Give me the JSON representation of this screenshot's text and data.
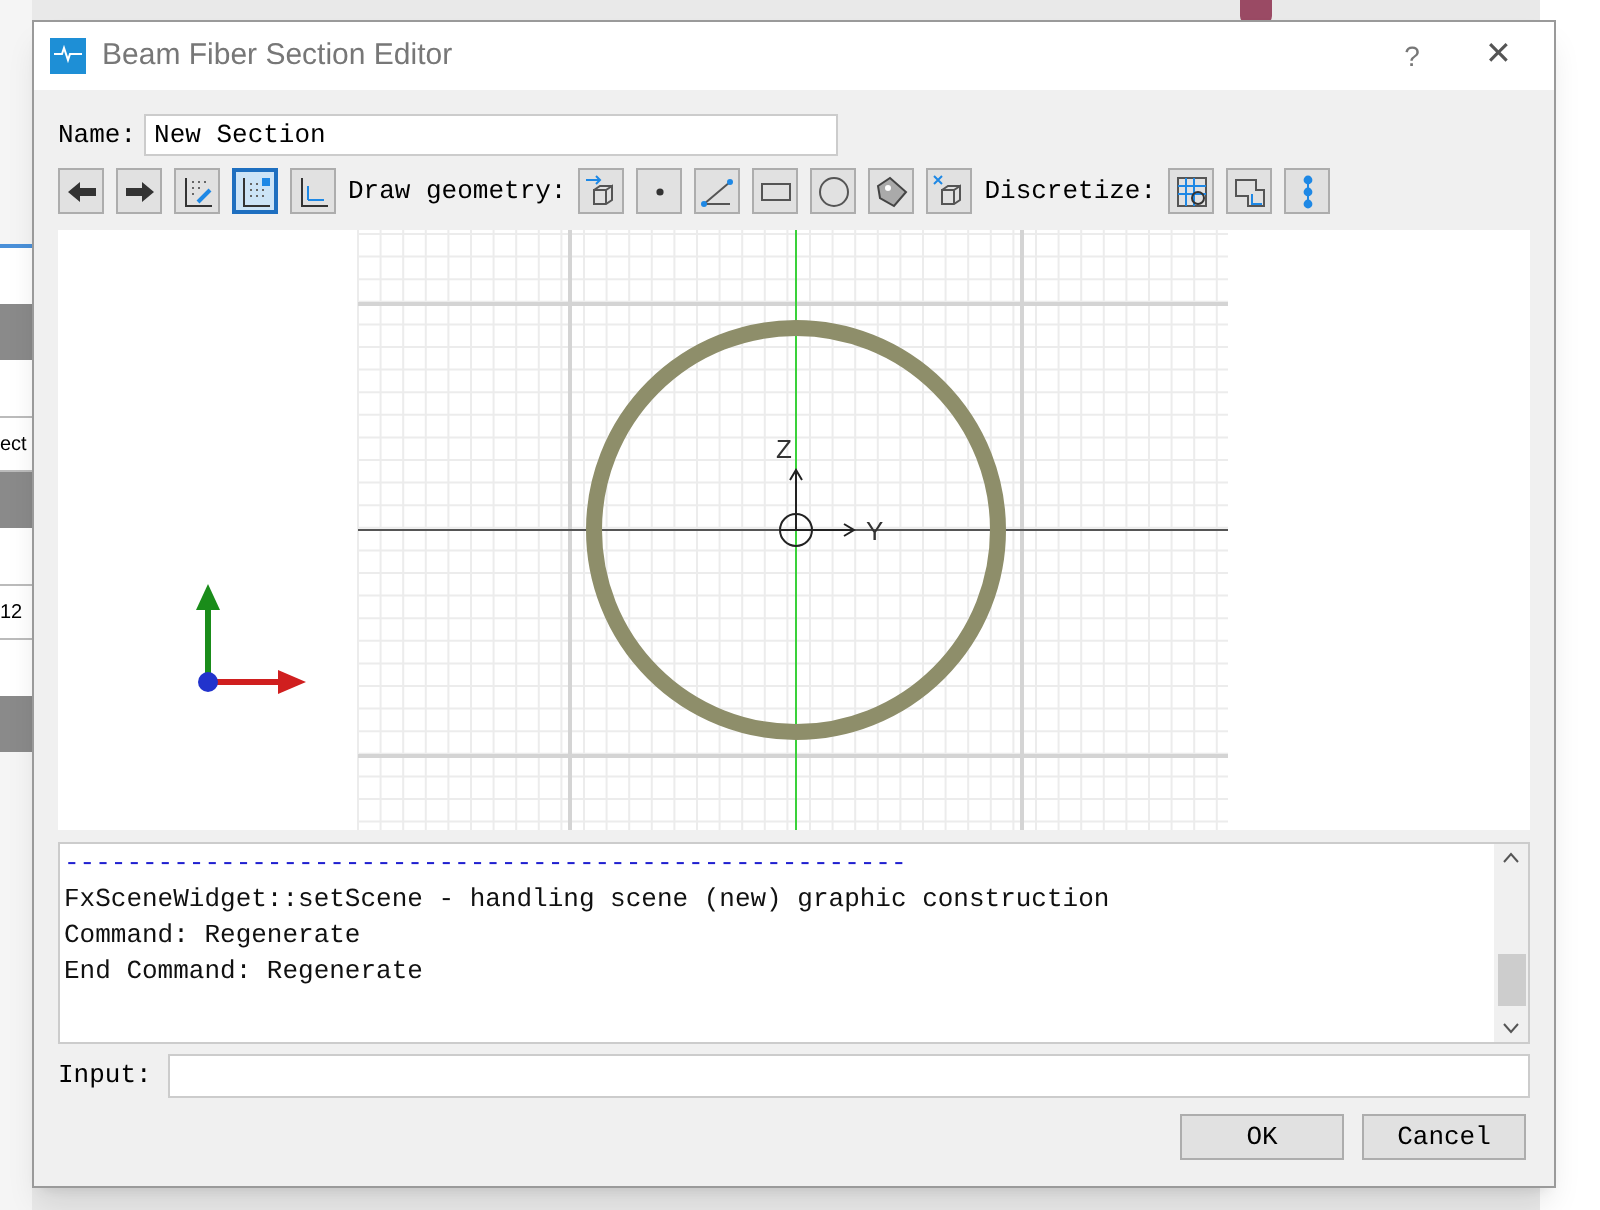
{
  "backdrop": {
    "left_texts": [
      "ect",
      "12"
    ]
  },
  "window": {
    "title": "Beam Fiber Section Editor",
    "help": "?",
    "close": "✕"
  },
  "name_field": {
    "label": "Name:",
    "value": "New Section"
  },
  "toolbar": [
    {
      "kind": "button",
      "selected": false
    },
    {
      "kind": "button",
      "selected": false
    },
    {
      "kind": "button",
      "selected": false
    },
    {
      "kind": "button",
      "selected": true
    },
    {
      "kind": "button",
      "selected": false
    },
    {
      "kind": "label",
      "text": "Draw geometry:"
    },
    {
      "kind": "button",
      "selected": false
    },
    {
      "kind": "button",
      "selected": false
    },
    {
      "kind": "button",
      "selected": false
    },
    {
      "kind": "button",
      "selected": false
    },
    {
      "kind": "button",
      "selected": false
    },
    {
      "kind": "button",
      "selected": false
    },
    {
      "kind": "button",
      "selected": false
    },
    {
      "kind": "label",
      "text": "Discretize:"
    },
    {
      "kind": "button",
      "selected": false
    },
    {
      "kind": "button",
      "selected": false
    },
    {
      "kind": "button",
      "selected": false
    }
  ],
  "viewport": {
    "axis_labels": [
      "Z",
      "Y"
    ]
  },
  "log": {
    "lines": [
      {
        "kind": "separator",
        "text": "------------------------------------------------------"
      },
      {
        "kind": "text",
        "text": "FxSceneWidget::setScene - handling scene (new) graphic construction"
      },
      {
        "kind": "text",
        "text": "Command: Regenerate"
      },
      {
        "kind": "text",
        "text": "End Command: Regenerate"
      }
    ]
  },
  "input": {
    "label": "Input:"
  },
  "buttons": [
    "OK",
    "Cancel"
  ]
}
